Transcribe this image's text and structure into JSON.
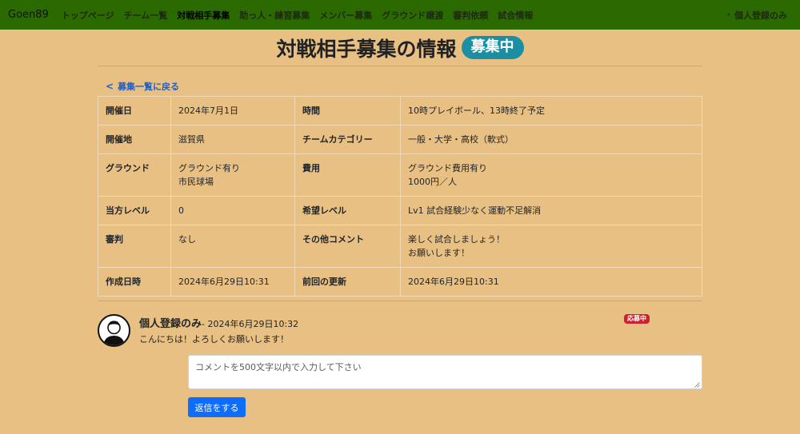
{
  "nav": {
    "brand": "Goen89",
    "links": [
      {
        "label": "トップページ"
      },
      {
        "label": "チーム一覧"
      },
      {
        "label": "対戦相手募集"
      },
      {
        "label": "助っ人・練習募集"
      },
      {
        "label": "メンバー募集"
      },
      {
        "label": "グラウンド譲渡"
      },
      {
        "label": "審判依頼"
      },
      {
        "label": "試合情報"
      }
    ],
    "right_label": "個人登録のみ",
    "right_icon": "chevron-left-icon"
  },
  "page": {
    "title": "対戦相手募集の情報",
    "status": "募集中",
    "back_link": "募集一覧に戻る",
    "back_icon": "chevron-left-icon"
  },
  "details": {
    "rows": [
      {
        "l1": "開催日",
        "v1": "2024年7月1日",
        "l2": "時間",
        "v2": "10時プレイボール、13時終了予定"
      },
      {
        "l1": "開催地",
        "v1": "滋賀県",
        "l2": "チームカテゴリー",
        "v2": "一般・大学・高校（軟式）"
      },
      {
        "l1": "グラウンド",
        "v1": "グラウンド有り\n市民球場",
        "l2": "費用",
        "v2": "グラウンド費用有り\n1000円／人"
      },
      {
        "l1": "当方レベル",
        "v1": "0",
        "l2": "希望レベル",
        "v2": "Lv1 試合経験少なく運動不足解消"
      },
      {
        "l1": "審判",
        "v1": "なし",
        "l2": "その他コメント",
        "v2": "楽しく試合しましょう！\nお願いします！\n "
      },
      {
        "l1": "作成日時",
        "v1": "2024年6月29日10:31",
        "l2": "前回の更新",
        "v2": "2024年6月29日10:31"
      }
    ]
  },
  "comment": {
    "author": "個人登録のみ",
    "time": "- 2024年6月29日10:32",
    "badge": "応募中",
    "body": "こんにちは！よろしくお願いします！",
    "avatar_icon": "user-avatar-icon"
  },
  "reply": {
    "placeholder": "コメントを500文字以内で入力して下さい",
    "button": "返信をする"
  },
  "colors": {
    "navbar": "#2b6a00",
    "background": "#e9c083",
    "status_pill": "#1a8fa4",
    "badge": "#c8232f",
    "link": "#1f5fc9",
    "primary_button": "#0d6efd"
  }
}
